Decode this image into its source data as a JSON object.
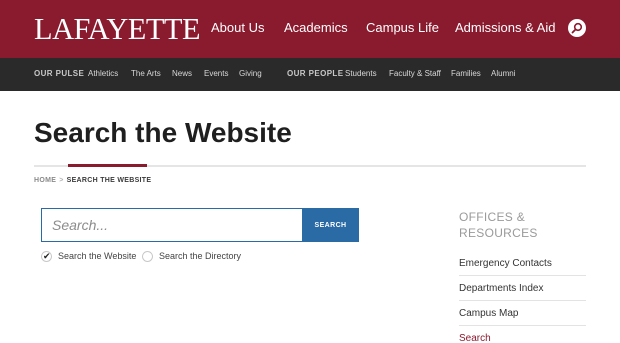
{
  "header": {
    "logo": "LAFAYETTE",
    "nav": [
      "About Us",
      "Academics",
      "Campus Life",
      "Admissions & Aid"
    ],
    "search_icon": "search-icon",
    "brand_color": "#8a1a2e"
  },
  "subnav": {
    "pulse_heading": "OUR PULSE",
    "pulse_items": [
      "Athletics",
      "The Arts",
      "News",
      "Events",
      "Giving"
    ],
    "people_heading": "OUR PEOPLE",
    "people_items": [
      "Students",
      "Faculty & Staff",
      "Families",
      "Alumni"
    ]
  },
  "page": {
    "title": "Search the Website"
  },
  "breadcrumb": {
    "home": "HOME",
    "separator": ">",
    "current": "SEARCH THE WEBSITE"
  },
  "search": {
    "placeholder": "Search...",
    "value": "",
    "button_label": "SEARCH",
    "options": [
      "Search the Website",
      "Search the Directory"
    ],
    "selected": "Search the Website",
    "accent_color": "#2a6ba6"
  },
  "sidebar": {
    "heading": "OFFICES & RESOURCES",
    "links": [
      "Emergency Contacts",
      "Departments Index",
      "Campus Map",
      "Search"
    ],
    "active": "Search"
  }
}
